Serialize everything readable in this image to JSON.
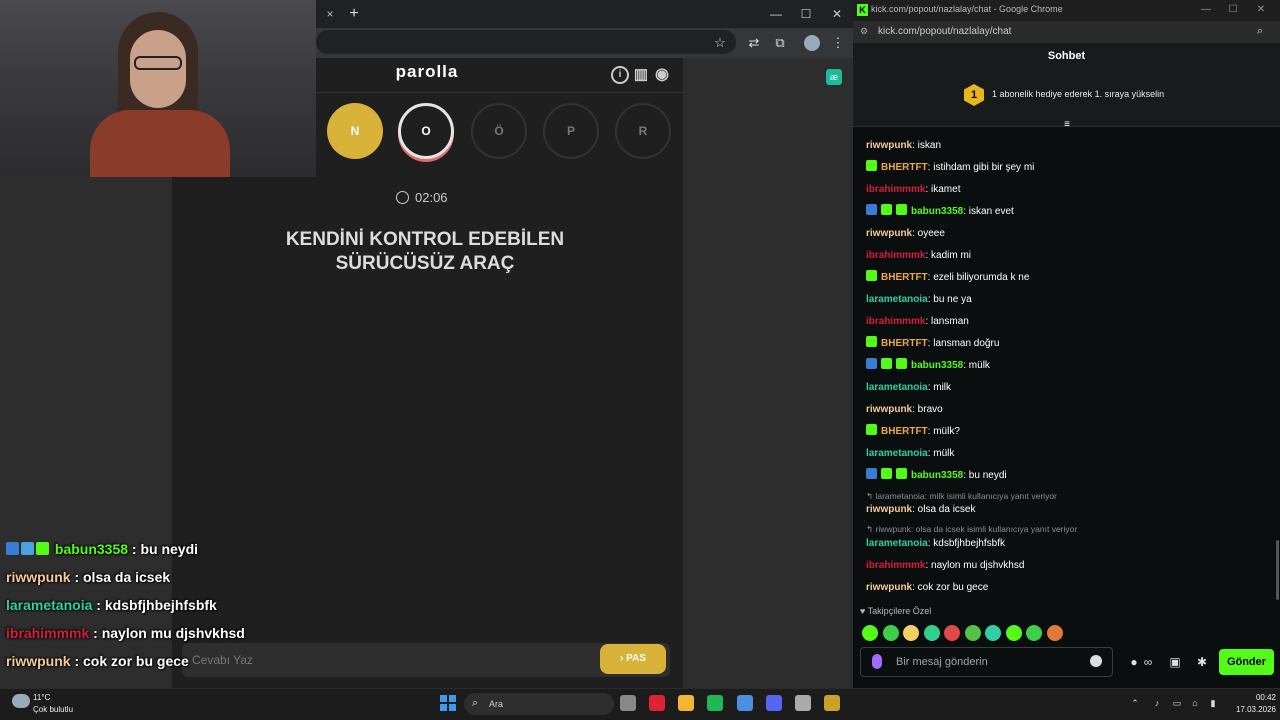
{
  "left_browser": {
    "tab_close": "×",
    "new_tab": "+",
    "controls": {
      "minimize": "—",
      "maximize": "☐",
      "close": "✕"
    },
    "toolbar_icons": {
      "star": "☆",
      "extensions": "⧉",
      "menu": "⋮"
    }
  },
  "game": {
    "title": "parolla",
    "letters": [
      {
        "char": "N",
        "state": "done"
      },
      {
        "char": "O",
        "state": "current"
      },
      {
        "char": "Ö",
        "state": "todo"
      },
      {
        "char": "P",
        "state": "todo"
      },
      {
        "char": "R",
        "state": "todo"
      }
    ],
    "timer": "02:06",
    "question_line1": "KENDİNİ KONTROL EDEBİLEN",
    "question_line2": "SÜRÜCÜSÜZ ARAÇ",
    "answer_placeholder": "Cevabı Yaz",
    "pass_label": "› PAS",
    "icons": {
      "info": "i",
      "stats": "▥",
      "profile": "◉"
    }
  },
  "overlay_chat": [
    {
      "user": "babun3358",
      "text": " : bu neydi",
      "color": "#53fc18",
      "badges": true
    },
    {
      "user": "riwwpunk",
      "text": " : olsa da icsek",
      "color": "#f3c99a",
      "badges": false
    },
    {
      "user": "larametanoia",
      "text": " : kdsbfjhbejhfsbfk",
      "color": "#2fd1a4",
      "badges": false
    },
    {
      "user": "ibrahimmmk",
      "text": " : naylon mu djshvkhsd",
      "color": "#d21f3c",
      "badges": false
    },
    {
      "user": "riwwpunk",
      "text": " : cok zor bu gece",
      "color": "#f3c99a",
      "badges": false
    }
  ],
  "chat_window": {
    "window_title": "kick.com/popout/nazlalay/chat - Google Chrome",
    "url": "kick.com/popout/nazlalay/chat",
    "header": "Sohbet",
    "pinned_rank": "1",
    "pinned_text": "1 abonelik hediye ederek 1. sıraya yükselin",
    "messages": [
      {
        "user": "riwwpunk",
        "text": ": iskan",
        "color": "#f3c99a",
        "badge": ""
      },
      {
        "user": "BHERTFT",
        "text": ": istihdam gibi bir şey mi",
        "color": "#e9a84a",
        "badge": "star"
      },
      {
        "user": "ibrahimmmk",
        "text": ": ikamet",
        "color": "#d21f3c",
        "badge": ""
      },
      {
        "user": "babun3358",
        "text": ": iskan evet",
        "color": "#53fc18",
        "badge": "multi"
      },
      {
        "user": "riwwpunk",
        "text": ": oyeee",
        "color": "#f3c99a",
        "badge": ""
      },
      {
        "user": "ibrahimmmk",
        "text": ": kadim mi",
        "color": "#d21f3c",
        "badge": ""
      },
      {
        "user": "BHERTFT",
        "text": ": ezeli biliyorumda k ne",
        "color": "#e9a84a",
        "badge": "star"
      },
      {
        "user": "larametanoia",
        "text": ": bu ne ya",
        "color": "#2fd1a4",
        "badge": ""
      },
      {
        "user": "ibrahimmmk",
        "text": ": lansman",
        "color": "#d21f3c",
        "badge": ""
      },
      {
        "user": "BHERTFT",
        "text": ": lansman doğru",
        "color": "#e9a84a",
        "badge": "star"
      },
      {
        "user": "babun3358",
        "text": ": mülk",
        "color": "#53fc18",
        "badge": "multi"
      },
      {
        "user": "larametanoia",
        "text": ": milk",
        "color": "#2fd1a4",
        "badge": ""
      },
      {
        "user": "riwwpunk",
        "text": ": bravo",
        "color": "#f3c99a",
        "badge": ""
      },
      {
        "user": "BHERTFT",
        "text": ": mülk?",
        "color": "#e9a84a",
        "badge": "star"
      },
      {
        "user": "larametanoia",
        "text": ": mülk",
        "color": "#2fd1a4",
        "badge": ""
      },
      {
        "user": "babun3358",
        "text": ": bu neydi",
        "color": "#53fc18",
        "badge": "multi"
      }
    ],
    "reply1_ref": "↰ larametanoia: milk isimli kullanıcıya yanıt veriyor",
    "reply1": {
      "user": "riwwpunk",
      "text": ": olsa da icsek",
      "color": "#f3c99a"
    },
    "reply2_ref": "↰ riwwpunk: olsa da icsek isimli kullanıcıya yanıt veriyor",
    "reply2": {
      "user": "larametanoia",
      "text": ": kdsbfjhbejhfsbfk",
      "color": "#2fd1a4"
    },
    "msg_after1": {
      "user": "ibrahimmmk",
      "text": ": naylon mu djshvkhsd",
      "color": "#d21f3c"
    },
    "msg_after2": {
      "user": "riwwpunk",
      "text": ": cok zor bu gece",
      "color": "#f3c99a"
    },
    "follower_label": "♥ Takipçilere Özel",
    "emote_colors": [
      "#53fc18",
      "#3ecf4a",
      "#f0d060",
      "#2fd18a",
      "#e14a4a",
      "#56c244",
      "#2fd1a4",
      "#53fc18",
      "#3ecf4a",
      "#e07a3a"
    ],
    "input_placeholder": "Bir mesaj gönderin",
    "send_label": "Gönder",
    "tool_icons": {
      "mention": "∞",
      "store": "▣",
      "settings": "✱"
    }
  },
  "taskbar": {
    "temperature": "11°C",
    "weather": "Çok bulutlu",
    "search_placeholder": "Ara",
    "time": "00:42",
    "date": "17.03.2026",
    "app_colors": [
      "#888",
      "#d23",
      "#f2b632",
      "#1db954",
      "#4a90e2",
      "#5865f2",
      "#aaa",
      "#c9a227"
    ]
  }
}
